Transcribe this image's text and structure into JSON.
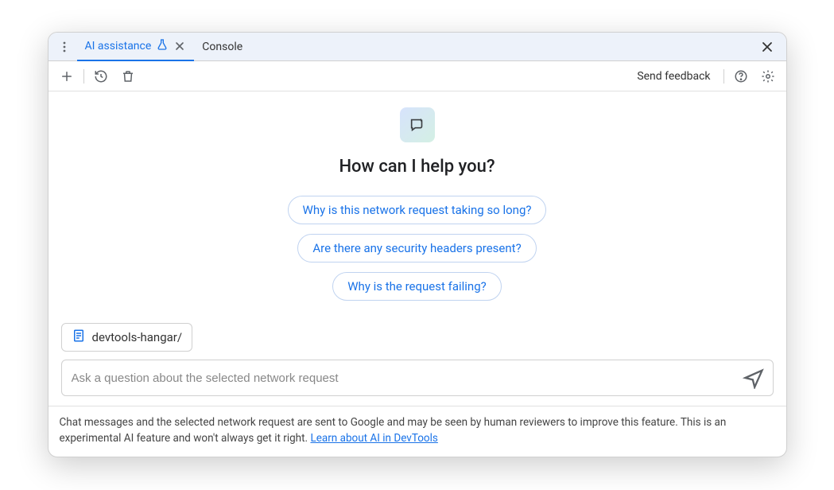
{
  "tabs": {
    "active": "AI assistance",
    "inactive": "Console"
  },
  "toolbar": {
    "send_feedback": "Send feedback"
  },
  "hero": {
    "title": "How can I help you?"
  },
  "suggestions": [
    "Why is this network request taking so long?",
    "Are there any security headers present?",
    "Why is the request failing?"
  ],
  "context": {
    "label": "devtools-hangar/"
  },
  "input": {
    "placeholder": "Ask a question about the selected network request"
  },
  "footer": {
    "text": "Chat messages and the selected network request are sent to Google and may be seen by human reviewers to improve this feature. This is an experimental AI feature and won't always get it right. ",
    "link": "Learn about AI in DevTools"
  }
}
